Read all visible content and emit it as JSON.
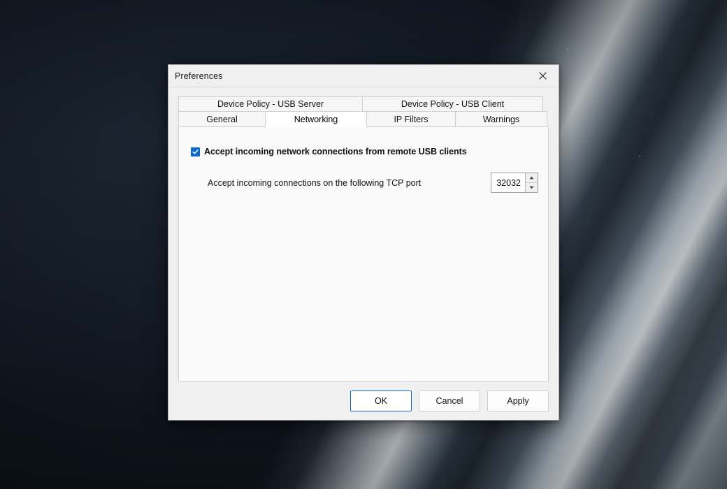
{
  "desktop": {
    "wallpaper_description": "dark blue abstract wallpaper with bright diagonal light streaks"
  },
  "dialog": {
    "title": "Preferences",
    "close_icon": "close-icon",
    "tabs": {
      "top_row": [
        {
          "label": "Device Policy - USB Server",
          "selected": false
        },
        {
          "label": "Device Policy - USB Client",
          "selected": false
        }
      ],
      "bottom_row": [
        {
          "label": "General",
          "selected": false
        },
        {
          "label": "Networking",
          "selected": true
        },
        {
          "label": "IP Filters",
          "selected": false
        },
        {
          "label": "Warnings",
          "selected": false
        }
      ]
    },
    "networking_page": {
      "accept_connections": {
        "label": "Accept incoming network connections from remote USB clients",
        "checked": true,
        "check_icon": "checkmark-icon"
      },
      "tcp_port": {
        "label": "Accept incoming connections on the following TCP port",
        "value": "32032",
        "increment_icon": "triangle-up-icon",
        "decrement_icon": "triangle-down-icon"
      }
    },
    "footer": {
      "ok_label": "OK",
      "cancel_label": "Cancel",
      "apply_label": "Apply"
    },
    "colors": {
      "accent": "#0b69c7",
      "dialog_background": "#f0f0f0",
      "page_background": "#fafafa"
    }
  }
}
